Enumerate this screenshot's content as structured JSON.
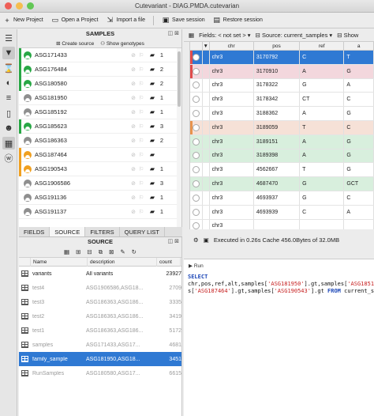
{
  "window": {
    "title": "Cutevariant - DIAG.PMDA.cutevarian"
  },
  "toolbar": {
    "new_project": "New Project",
    "open_project": "Open a Project",
    "import_file": "Import a file",
    "save_session": "Save session",
    "restore_session": "Restore session"
  },
  "samples": {
    "title": "SAMPLES",
    "create_source": "Create source",
    "show_genotypes": "Show genotypes",
    "rows": [
      {
        "name": "ASG171433",
        "count": "1",
        "status": "green"
      },
      {
        "name": "ASG176484",
        "count": "2",
        "status": "green"
      },
      {
        "name": "ASG180580",
        "count": "2",
        "status": "green"
      },
      {
        "name": "ASG181950",
        "count": "1",
        "status": "grey"
      },
      {
        "name": "ASG185192",
        "count": "1",
        "status": "grey"
      },
      {
        "name": "ASG185623",
        "count": "3",
        "status": "green"
      },
      {
        "name": "ASG186363",
        "count": "2",
        "status": "grey"
      },
      {
        "name": "ASG187464",
        "count": "",
        "status": "orange"
      },
      {
        "name": "ASG190543",
        "count": "1",
        "status": "orange"
      },
      {
        "name": "ASG1906586",
        "count": "3",
        "status": "grey"
      },
      {
        "name": "ASG191136",
        "count": "1",
        "status": "grey"
      },
      {
        "name": "ASG191137",
        "count": "1",
        "status": "grey"
      }
    ]
  },
  "tabs": [
    {
      "label": "FIELDS"
    },
    {
      "label": "SOURCE"
    },
    {
      "label": "FILTERS"
    },
    {
      "label": "QUERY LIST"
    }
  ],
  "source": {
    "title": "SOURCE",
    "columns": {
      "name": "Name",
      "description": "description",
      "count": "count"
    },
    "rows": [
      {
        "name": "variants",
        "description": "All variants",
        "count": "23927"
      },
      {
        "name": "test4",
        "description": "ASG1906586,ASG18...",
        "count": "2709"
      },
      {
        "name": "test3",
        "description": "ASG186363,ASG186...",
        "count": "3335"
      },
      {
        "name": "test2",
        "description": "ASG186363,ASG186...",
        "count": "3419"
      },
      {
        "name": "test1",
        "description": "ASG186363,ASG186...",
        "count": "5172"
      },
      {
        "name": "samples",
        "description": "ASG171433,ASG17...",
        "count": "4681"
      },
      {
        "name": "family_sample",
        "description": "ASG181950,ASG18...",
        "count": "3451"
      },
      {
        "name": "RunSamples",
        "description": "ASG180580,ASG17...",
        "count": "6615"
      }
    ]
  },
  "right": {
    "fields_label": "Fields: < not set >",
    "source_label": "Source: current_samples",
    "show_label": "Show",
    "columns": [
      "chr",
      "pos",
      "ref",
      "a"
    ],
    "rows": [
      {
        "chr": "chr3",
        "pos": "3170792",
        "ref": "C",
        "alt": "T",
        "bg": "#2f79d3",
        "fg": "#ffffff",
        "mark": "#e04c4c"
      },
      {
        "chr": "chr3",
        "pos": "3170910",
        "ref": "A",
        "alt": "G",
        "bg": "#f3d7dd",
        "fg": "#222222",
        "mark": "#e04c4c"
      },
      {
        "chr": "chr3",
        "pos": "3178322",
        "ref": "G",
        "alt": "A",
        "bg": "#ffffff",
        "fg": "#222222",
        "mark": ""
      },
      {
        "chr": "chr3",
        "pos": "3178342",
        "ref": "CT",
        "alt": "C",
        "bg": "#ffffff",
        "fg": "#222222",
        "mark": ""
      },
      {
        "chr": "chr3",
        "pos": "3188362",
        "ref": "A",
        "alt": "G",
        "bg": "#ffffff",
        "fg": "#222222",
        "mark": ""
      },
      {
        "chr": "chr3",
        "pos": "3189059",
        "ref": "T",
        "alt": "C",
        "bg": "#f6e1d7",
        "fg": "#222222",
        "mark": "#e8934d"
      },
      {
        "chr": "chr3",
        "pos": "3189151",
        "ref": "A",
        "alt": "G",
        "bg": "#d8efdd",
        "fg": "#222222",
        "mark": ""
      },
      {
        "chr": "chr3",
        "pos": "3189398",
        "ref": "A",
        "alt": "G",
        "bg": "#d8efdd",
        "fg": "#222222",
        "mark": ""
      },
      {
        "chr": "chr3",
        "pos": "4562667",
        "ref": "T",
        "alt": "G",
        "bg": "#ffffff",
        "fg": "#222222",
        "mark": ""
      },
      {
        "chr": "chr3",
        "pos": "4687470",
        "ref": "G",
        "alt": "GCT",
        "bg": "#d8efdd",
        "fg": "#222222",
        "mark": ""
      },
      {
        "chr": "chr3",
        "pos": "4693937",
        "ref": "G",
        "alt": "C",
        "bg": "#ffffff",
        "fg": "#222222",
        "mark": ""
      },
      {
        "chr": "chr3",
        "pos": "4693939",
        "ref": "C",
        "alt": "A",
        "bg": "#ffffff",
        "fg": "#222222",
        "mark": ""
      },
      {
        "chr": "chr3",
        "pos": "",
        "ref": "",
        "alt": "",
        "bg": "#ffffff",
        "fg": "#222222",
        "mark": ""
      }
    ],
    "stats": "Executed in 0.26s  Cache 456.0Bytes of 32.0MB",
    "run_label": "Run",
    "sql": {
      "select": "SELECT",
      "line1_pre": "chr,pos,ref,alt,samples[",
      "s1": "'ASG181950'",
      "mid1": "].gt,samples[",
      "s2": "'ASG185192'",
      "mid1b": "].",
      "line2_pre": "s[",
      "s3": "'ASG187464'",
      "mid2": "].gt,samples[",
      "s4": "'ASG190543'",
      "mid3": "].gt ",
      "from": "FROM",
      "tail": " current_samp"
    }
  },
  "colors": {
    "green": "#28a745",
    "grey": "#8f8f8f",
    "orange": "#f0a020",
    "selection": "#2f79d3"
  }
}
